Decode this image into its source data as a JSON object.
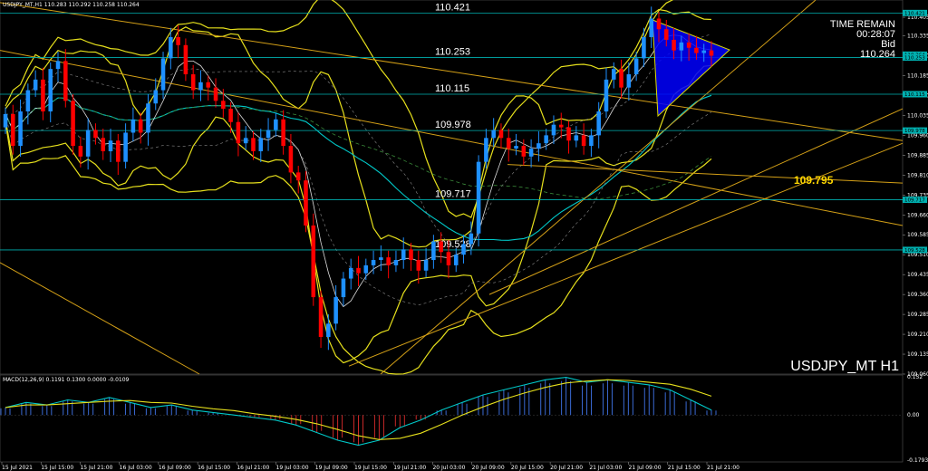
{
  "header": {
    "symbol_line": "USDJPY_MT,H1  110.283 110.292 110.258 110.264"
  },
  "overlay": {
    "time_remain_label": "TIME REMAIN",
    "time_remain_value": "00:28:07",
    "bid_label": "Bid",
    "bid_value": "110.264",
    "watermark": "USDJPY_MT H1",
    "highlight_level": "109.795"
  },
  "macd": {
    "label": "MACD(12,26,9) 0.1191 0.1300 0.0000 -0.0109",
    "axis_ticks": [
      "0.152",
      "0.00",
      "-0.1793"
    ]
  },
  "colors": {
    "background": "#000000",
    "bull_candle": "#1e90ff",
    "bear_candle": "#ff0000",
    "bollinger": "#e6e01c",
    "ma_cyan": "#00c8c8",
    "level_line": "#00b0b0",
    "trendline": "#d4a017",
    "triangle_fill": "#0000ff",
    "highlight_text": "#ffd700"
  },
  "chart_data": {
    "type": "candlestick",
    "symbol": "USDJPY_MT",
    "timeframe": "H1",
    "ylim": [
      109.06,
      110.47
    ],
    "y_axis_ticks": [
      "110.480",
      "110.405",
      "110.335",
      "110.260",
      "110.185",
      "110.110",
      "110.035",
      "109.960",
      "109.885",
      "109.810",
      "109.735",
      "109.660",
      "109.585",
      "109.510",
      "109.435",
      "109.360",
      "109.285",
      "109.210",
      "109.135",
      "109.060"
    ],
    "price_tags": [
      "110.421",
      "110.264",
      "110.253",
      "110.115",
      "109.978",
      "109.717",
      "109.528"
    ],
    "x_axis_labels": [
      "15 Jul 2021",
      "15 Jul 15:00",
      "15 Jul 21:00",
      "16 Jul 03:00",
      "16 Jul 09:00",
      "16 Jul 15:00",
      "16 Jul 21:00",
      "19 Jul 03:00",
      "19 Jul 09:00",
      "19 Jul 15:00",
      "19 Jul 21:00",
      "20 Jul 03:00",
      "20 Jul 09:00",
      "20 Jul 15:00",
      "20 Jul 21:00",
      "21 Jul 03:00",
      "21 Jul 09:00",
      "21 Jul 15:00",
      "21 Jul 21:00"
    ],
    "levels": [
      110.421,
      110.253,
      110.115,
      109.978,
      109.717,
      109.528
    ],
    "closes": [
      110.04,
      109.92,
      110.05,
      110.13,
      110.17,
      110.05,
      110.21,
      110.24,
      110.09,
      109.92,
      109.88,
      109.98,
      109.95,
      109.9,
      109.94,
      109.86,
      109.97,
      110.02,
      109.97,
      110.08,
      110.13,
      110.25,
      110.33,
      110.3,
      110.19,
      110.13,
      110.16,
      110.14,
      110.09,
      110.06,
      110.01,
      109.93,
      109.95,
      109.9,
      109.95,
      109.98,
      110.02,
      109.92,
      109.82,
      109.79,
      109.62,
      109.35,
      109.2,
      109.25,
      109.35,
      109.42,
      109.46,
      109.44,
      109.47,
      109.49,
      109.5,
      109.47,
      109.49,
      109.53,
      109.49,
      109.45,
      109.49,
      109.56,
      109.52,
      109.47,
      109.51,
      109.55,
      109.59,
      109.86,
      109.95,
      109.98,
      109.95,
      109.91,
      109.92,
      109.88,
      109.91,
      109.93,
      109.96,
      110.0,
      109.99,
      109.94,
      109.96,
      109.92,
      109.96,
      110.05,
      110.17,
      110.21,
      110.14,
      110.19,
      110.25,
      110.33,
      110.4,
      110.36,
      110.32,
      110.28,
      110.31,
      110.29,
      110.27,
      110.28,
      110.26
    ],
    "series": [
      {
        "name": "MACD(12,26,9)",
        "type": "histogram",
        "values": [
          0.03,
          0.05,
          0.04,
          0.06,
          0.05,
          0.07,
          0.05,
          0.03,
          0.04,
          0.02,
          0.01,
          0.0,
          -0.01,
          -0.02,
          -0.04,
          -0.07,
          -0.1,
          -0.12,
          -0.1,
          -0.05,
          -0.02,
          0.02,
          0.05,
          0.08,
          0.1,
          0.12,
          0.14,
          0.15,
          0.13,
          0.14,
          0.13,
          0.12,
          0.1,
          0.06,
          0.02
        ]
      }
    ]
  }
}
